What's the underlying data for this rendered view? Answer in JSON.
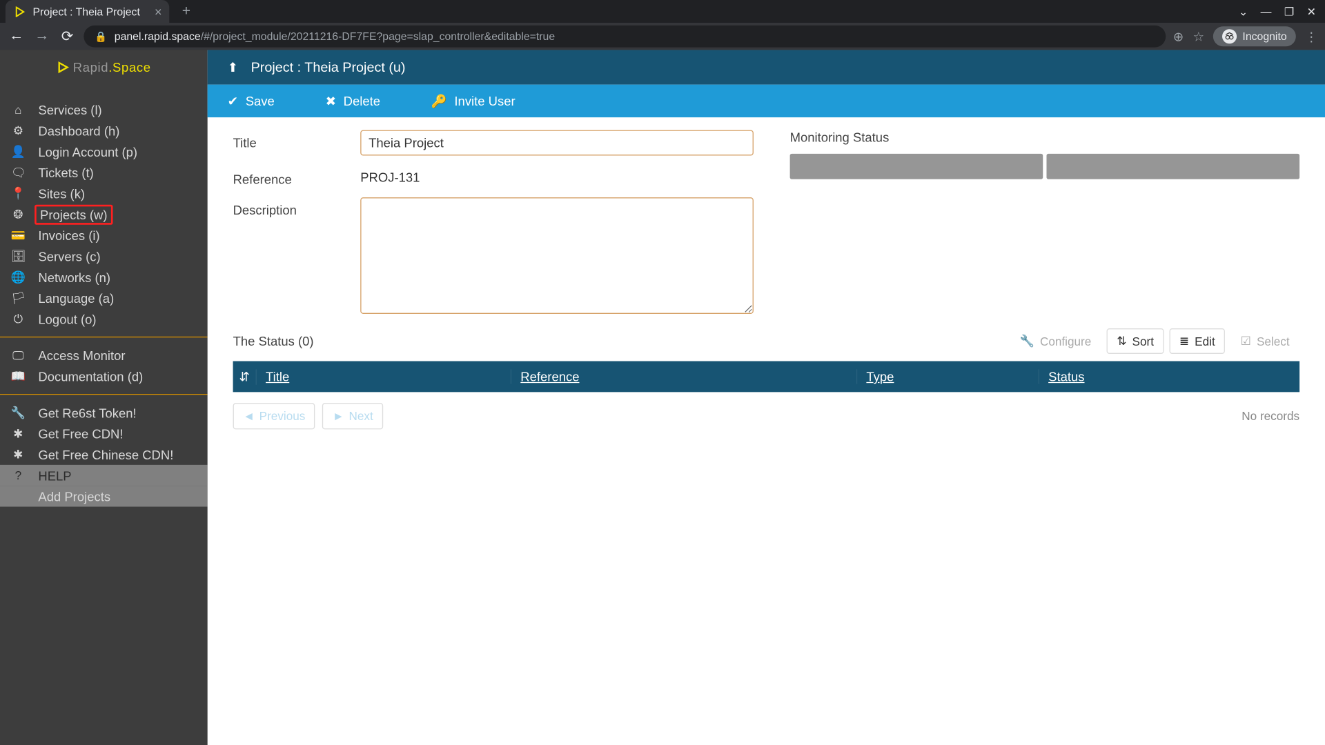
{
  "browser": {
    "tab_title": "Project : Theia Project",
    "url_host": "panel.rapid.space",
    "url_path": "/#/project_module/20211216-DF7FE?page=slap_controller&editable=true",
    "incognito_label": "Incognito"
  },
  "logo": {
    "brand1": "Rapid",
    "brand2": ".Space"
  },
  "sidebar": {
    "group1": [
      {
        "icon": "home",
        "label": "Services (l)"
      },
      {
        "icon": "dashboard",
        "label": "Dashboard (h)"
      },
      {
        "icon": "user",
        "label": "Login Account (p)"
      },
      {
        "icon": "comment",
        "label": "Tickets (t)"
      },
      {
        "icon": "marker",
        "label": "Sites (k)"
      },
      {
        "icon": "cubes",
        "label": "Projects (w)",
        "highlighted": true
      },
      {
        "icon": "card",
        "label": "Invoices (i)"
      },
      {
        "icon": "database",
        "label": "Servers (c)"
      },
      {
        "icon": "globe",
        "label": "Networks (n)"
      },
      {
        "icon": "language",
        "label": "Language (a)"
      },
      {
        "icon": "power",
        "label": "Logout (o)"
      }
    ],
    "group2": [
      {
        "icon": "monitor",
        "label": "Access Monitor"
      },
      {
        "icon": "book",
        "label": "Documentation (d)"
      }
    ],
    "group3": [
      {
        "icon": "key",
        "label": "Get Re6st Token!"
      },
      {
        "icon": "ast",
        "label": "Get Free CDN!"
      },
      {
        "icon": "ast",
        "label": "Get Free Chinese CDN!"
      }
    ],
    "help": {
      "label": "HELP",
      "sub": "Add Projects"
    }
  },
  "header": {
    "title": "Project : Theia Project (u)"
  },
  "actions": {
    "save": "Save",
    "delete": "Delete",
    "invite": "Invite User"
  },
  "form": {
    "title_label": "Title",
    "title_value": "Theia Project",
    "reference_label": "Reference",
    "reference_value": "PROJ-131",
    "description_label": "Description",
    "description_value": "",
    "monitoring_label": "Monitoring Status"
  },
  "status_table": {
    "title": "The Status (0)",
    "tools": {
      "configure": "Configure",
      "sort": "Sort",
      "edit": "Edit",
      "select": "Select"
    },
    "columns": {
      "title": "Title",
      "reference": "Reference",
      "type": "Type",
      "status": "Status"
    },
    "pagination": {
      "prev": "Previous",
      "next": "Next",
      "empty": "No records"
    }
  }
}
